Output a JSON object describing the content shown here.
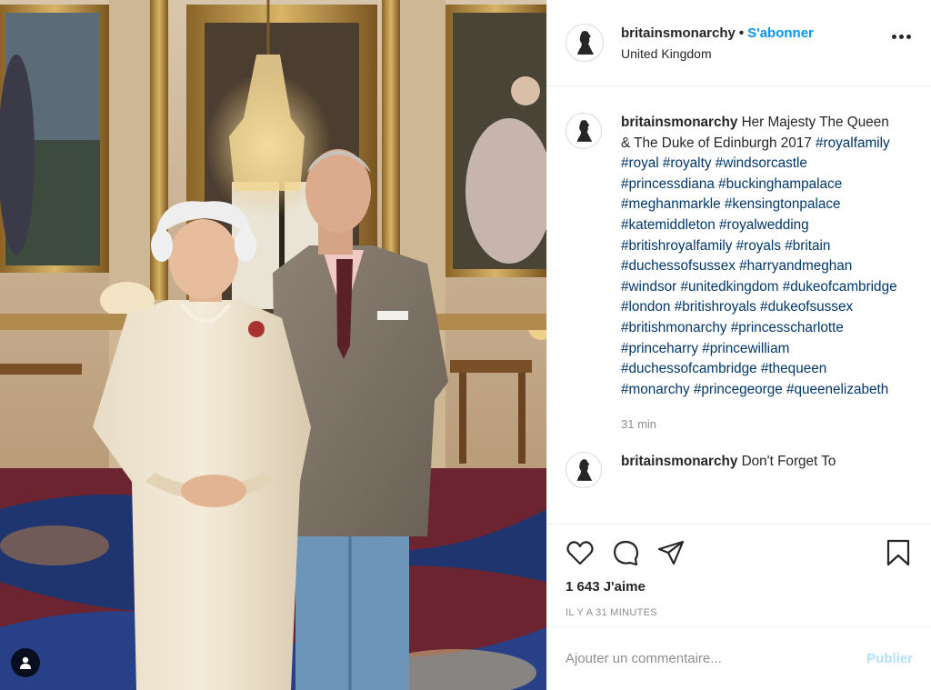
{
  "post": {
    "username": "britainsmonarchy",
    "follow_label": "S'abonner",
    "separator": "•",
    "location": "United Kingdom",
    "more_icon": "more-horizontal-icon"
  },
  "caption": {
    "username": "britainsmonarchy",
    "text": "Her Majesty The Queen & The Duke of Edinburgh 2017",
    "hashtags": "#royalfamily #royal #royalty #windsorcastle #princessdiana #buckinghampalace #meghanmarkle #kensingtonpalace #katemiddleton #royalwedding #britishroyalfamily #royals #britain #duchessofsussex #harryandmeghan #windsor #unitedkingdom #dukeofcambridge #london #britishroyals #dukeofsussex #britishmonarchy #princesscharlotte #princeharry #princewilliam #duchessofcambridge #thequeen #monarchy #princegeorge #queenelizabeth",
    "time": "31 min"
  },
  "next_comment": {
    "username": "britainsmonarchy",
    "text": "Don't Forget To"
  },
  "actions": {
    "likes": "1 643 J'aime",
    "posted_ago": "IL Y A 31 MINUTES",
    "comment_placeholder": "Ajouter un commentaire...",
    "publish_label": "Publier"
  },
  "colors": {
    "accent": "#0095f6",
    "hashtag": "#00376b",
    "muted": "#8e8e8e",
    "publish_disabled": "#b2dffc"
  }
}
